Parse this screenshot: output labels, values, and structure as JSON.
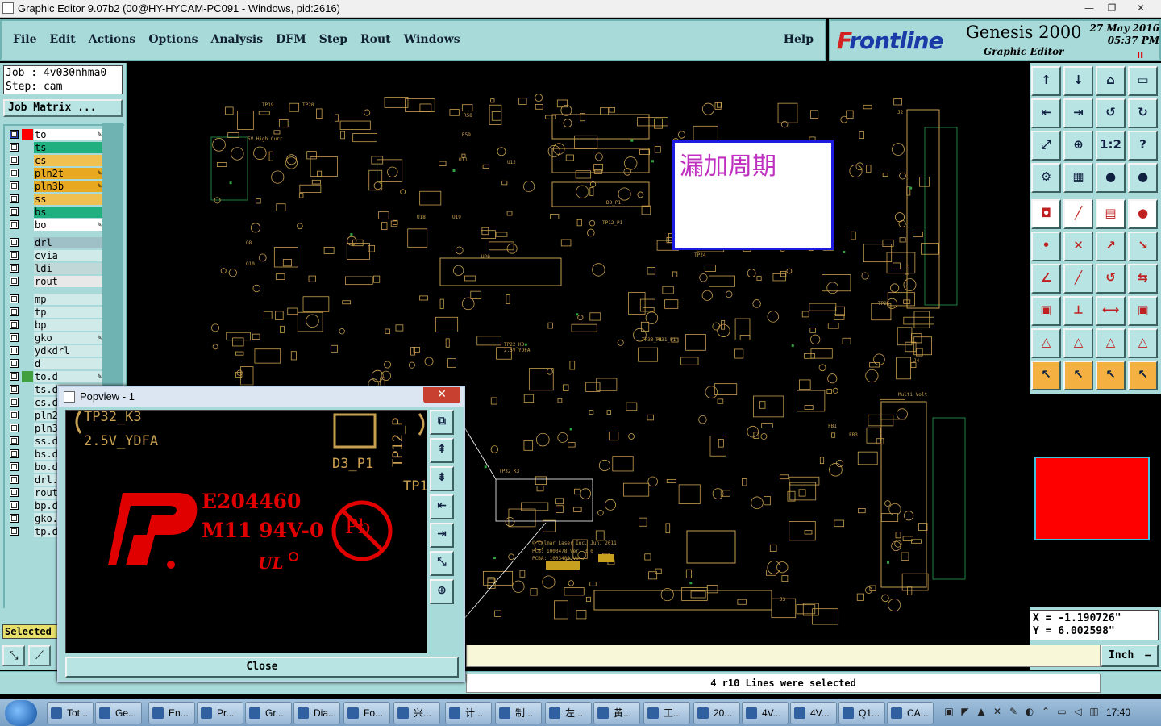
{
  "window": {
    "title": "Graphic Editor 9.07b2 (00@HY-HYCAM-PC091 - Windows, pid:2616)"
  },
  "menu": {
    "items": [
      "File",
      "Edit",
      "Actions",
      "Options",
      "Analysis",
      "DFM",
      "Step",
      "Rout",
      "Windows"
    ],
    "help": "Help"
  },
  "brand": {
    "logo_prefix": "F",
    "logo_rest": "rontline",
    "product": "Genesis 2000",
    "subtitle": "Graphic Editor",
    "date": "27 May 2016",
    "time": "05:37 PM",
    "pause": "II"
  },
  "job": {
    "job_line": "Job : 4v030nhma0",
    "step_line": "Step: cam",
    "matrix_button": "Job Matrix ..."
  },
  "layers": [
    {
      "name": "to",
      "color": "#ffffff",
      "swatch": "#ff0000",
      "pen": true,
      "active": true
    },
    {
      "name": "ts",
      "color": "#20b080",
      "swatch": "",
      "pen": false
    },
    {
      "name": "cs",
      "color": "#f0c050",
      "swatch": "",
      "pen": false
    },
    {
      "name": "pln2t",
      "color": "#e8a820",
      "swatch": "",
      "pen": true
    },
    {
      "name": "pln3b",
      "color": "#e8a820",
      "swatch": "",
      "pen": true
    },
    {
      "name": "ss",
      "color": "#f0c050",
      "swatch": "",
      "pen": false
    },
    {
      "name": "bs",
      "color": "#20b080",
      "swatch": "",
      "pen": false
    },
    {
      "name": "bo",
      "color": "#ffffff",
      "swatch": "",
      "pen": true
    },
    {
      "name": "drl",
      "color": "#a0c0c8",
      "swatch": "",
      "pen": false
    },
    {
      "name": "cvia",
      "color": "#d0eaea",
      "swatch": "",
      "pen": false
    },
    {
      "name": "ldi",
      "color": "#c0d8d8",
      "swatch": "",
      "pen": false
    },
    {
      "name": "rout",
      "color": "#e8e8e8",
      "swatch": "",
      "pen": false
    },
    {
      "name": "mp",
      "color": "#d0eaea",
      "swatch": "",
      "pen": false
    },
    {
      "name": "tp",
      "color": "#d0eaea",
      "swatch": "",
      "pen": false
    },
    {
      "name": "bp",
      "color": "#d0eaea",
      "swatch": "",
      "pen": false
    },
    {
      "name": "gko",
      "color": "#d0eaea",
      "swatch": "",
      "pen": true
    },
    {
      "name": "ydkdrl",
      "color": "#d0eaea",
      "swatch": "",
      "pen": false
    },
    {
      "name": "d",
      "color": "#d0eaea",
      "swatch": "",
      "pen": false
    },
    {
      "name": "to.d",
      "color": "#d0eaea",
      "swatch": "#40a040",
      "pen": true
    },
    {
      "name": "ts.d",
      "color": "#d0eaea",
      "swatch": "",
      "pen": false
    },
    {
      "name": "cs.d",
      "color": "#d0eaea",
      "swatch": "",
      "pen": false
    },
    {
      "name": "pln2",
      "color": "#d0eaea",
      "swatch": "",
      "pen": false
    },
    {
      "name": "pln3",
      "color": "#d0eaea",
      "swatch": "",
      "pen": false
    },
    {
      "name": "ss.d",
      "color": "#d0eaea",
      "swatch": "",
      "pen": false
    },
    {
      "name": "bs.d",
      "color": "#d0eaea",
      "swatch": "",
      "pen": false
    },
    {
      "name": "bo.d",
      "color": "#d0eaea",
      "swatch": "",
      "pen": false
    },
    {
      "name": "drl.",
      "color": "#d0eaea",
      "swatch": "",
      "pen": false
    },
    {
      "name": "rout",
      "color": "#d0eaea",
      "swatch": "",
      "pen": false
    },
    {
      "name": "bp.d",
      "color": "#d0eaea",
      "swatch": "",
      "pen": false
    },
    {
      "name": "gko.",
      "color": "#d0eaea",
      "swatch": "",
      "pen": false
    },
    {
      "name": "tp.d",
      "color": "#d0eaea",
      "swatch": "",
      "pen": false
    }
  ],
  "selected_label": "Selected",
  "callout": {
    "text": "漏加周期"
  },
  "pcb_labels": [
    "TP19",
    "TP20",
    "5V High Curr",
    "TP22_K3",
    "2.5V_YDFA",
    "TP32_K3",
    "TP30_P1",
    "TP31_P1",
    "TP24",
    "TP25",
    "J2",
    "J3",
    "J4",
    "U11",
    "U12",
    "U18",
    "U19",
    "U20",
    "FB1",
    "FB3",
    "Multi Volt",
    "R58",
    "R59",
    "Q8",
    "Q10",
    "D3_P1",
    "TP12_P1",
    "© Calmar Laser Inc. Jun. 2011",
    "PCB: 1003478  Ver. 3.0",
    "PCBA: 1003480  Ver."
  ],
  "coords": {
    "x": "X = -1.190726\"",
    "y": "Y = 6.002598\""
  },
  "units": {
    "label": "Inch"
  },
  "status": {
    "message": "4 r10 Lines were selected"
  },
  "popview": {
    "title": "Popview - 1",
    "close_label": "Close",
    "text_tp32": "TP32_K3",
    "text_25v": "2.5V_YDFA",
    "text_d3": "D3_P1",
    "text_tp12": "TP12_P",
    "text_tp1": "TP1",
    "ul_number": "E204460",
    "rating": "M11 94V-0",
    "pb": "Pb"
  },
  "taskbar": {
    "items": [
      "Tot...",
      "Ge...",
      "En...",
      "Pr...",
      "Gr...",
      "Dia...",
      "Fo...",
      "兴...",
      "计...",
      "制...",
      "左...",
      "黄...",
      "工...",
      "20...",
      "4V...",
      "4V...",
      "Q1...",
      "CA..."
    ],
    "clock": "17:40"
  }
}
